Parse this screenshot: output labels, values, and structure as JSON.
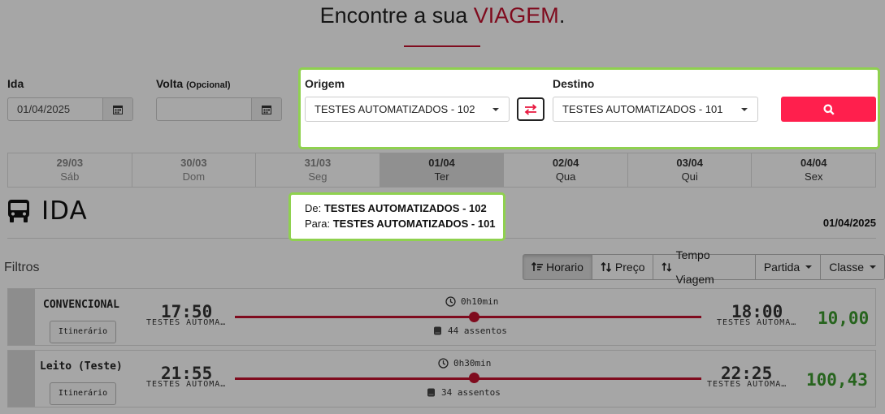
{
  "header": {
    "title_prefix": "Encontre a sua ",
    "title_accent": "VIAGEM",
    "title_suffix": "."
  },
  "form": {
    "ida_label": "Ida",
    "ida_value": "01/04/2025",
    "volta_label": "Volta",
    "volta_optional": "(Opcional)",
    "volta_value": "",
    "origem_label": "Origem",
    "origem_value": "TESTES AUTOMATIZADOS - 102",
    "destino_label": "Destino",
    "destino_value": "TESTES AUTOMATIZADOS - 101"
  },
  "days": [
    {
      "date": "29/03",
      "weekday": "Sáb"
    },
    {
      "date": "30/03",
      "weekday": "Dom"
    },
    {
      "date": "31/03",
      "weekday": "Seg"
    },
    {
      "date": "01/04",
      "weekday": "Ter"
    },
    {
      "date": "02/04",
      "weekday": "Qua"
    },
    {
      "date": "03/04",
      "weekday": "Qui"
    },
    {
      "date": "04/04",
      "weekday": "Sex"
    }
  ],
  "results": {
    "heading": "IDA",
    "from_label": "De:",
    "from_value": "TESTES AUTOMATIZADOS - 102",
    "to_label": "Para:",
    "to_value": "TESTES AUTOMATIZADOS - 101",
    "date": "01/04/2025",
    "filters_label": "Filtros"
  },
  "sort": {
    "horario": "Horario",
    "preco": "Preço",
    "tempo": "Tempo Viagem",
    "partida": "Partida",
    "classe": "Classe"
  },
  "trips": [
    {
      "class": "CONVENCIONAL",
      "itinerary": "Itinerário",
      "depart_time": "17:50",
      "depart_place": "TESTES AUTOMA…",
      "duration": "0h10min",
      "seats": "44 assentos",
      "arrive_time": "18:00",
      "arrive_place": "TESTES AUTOMA…",
      "price": "10,00"
    },
    {
      "class": "Leito (Teste)",
      "itinerary": "Itinerário",
      "depart_time": "21:55",
      "depart_place": "TESTES AUTOMA…",
      "duration": "0h30min",
      "seats": "34 assentos",
      "arrive_time": "22:25",
      "arrive_place": "TESTES AUTOMA…",
      "price": "100,43"
    }
  ],
  "colors": {
    "accent": "#c4122f",
    "search_button": "#ff1f4d",
    "highlight": "#8fd14f",
    "price": "#3d9a2e"
  }
}
